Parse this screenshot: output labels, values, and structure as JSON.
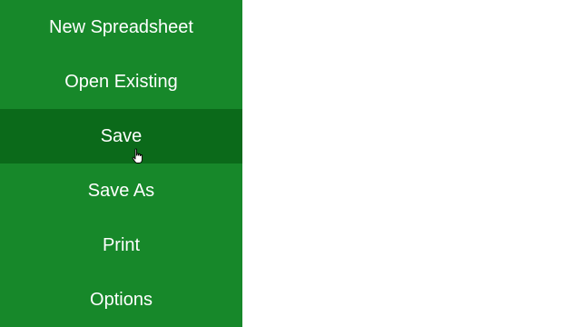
{
  "menu": {
    "items": [
      {
        "label": "New Spreadsheet"
      },
      {
        "label": "Open Existing"
      },
      {
        "label": "Save"
      },
      {
        "label": "Save As"
      },
      {
        "label": "Print"
      },
      {
        "label": "Options"
      }
    ],
    "active_item": "Save"
  },
  "colors": {
    "menu_background": "#17882a",
    "active_background": "#0b6a1a",
    "text": "#ffffff",
    "content_background": "#ffffff"
  },
  "cursor": {
    "icon": "hand-pointer-icon"
  }
}
